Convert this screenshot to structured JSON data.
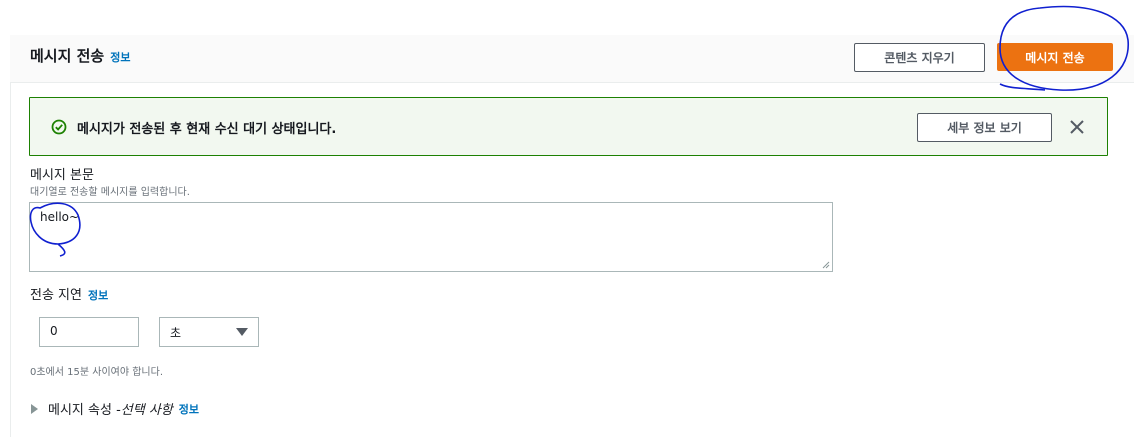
{
  "header": {
    "title": "메시지 전송",
    "info_link": "정보",
    "clear_button": "콘텐츠 지우기",
    "send_button": "메시지 전송"
  },
  "alert": {
    "icon": "check-circle-icon",
    "message": "메시지가 전송된 후 현재 수신 대기 상태입니다.",
    "details_button": "세부 정보 보기",
    "close_icon": "close-icon"
  },
  "body_field": {
    "label": "메시지 본문",
    "description": "대기열로 전송할 메시지를 입력합니다.",
    "value": "hello~"
  },
  "delay_field": {
    "label": "전송 지연",
    "info_link": "정보",
    "value": "0",
    "unit": "초",
    "constraint": "0초에서 15분 사이여야 합니다."
  },
  "attributes": {
    "label": "메시지 속성 - ",
    "optional": "선택 사항",
    "info_link": "정보"
  },
  "colors": {
    "accent": "#ec7211",
    "link": "#0073bb",
    "success": "#1d8102",
    "annotation": "#1020d0"
  }
}
